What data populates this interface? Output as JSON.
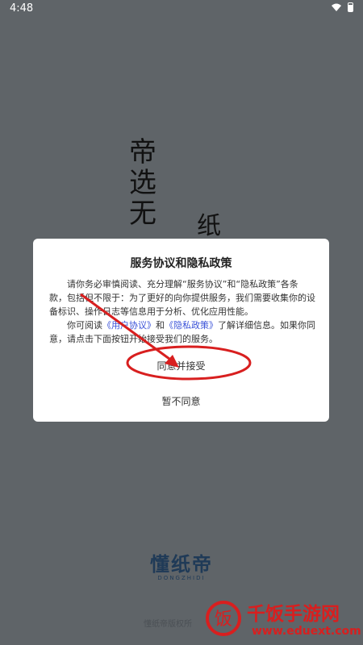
{
  "status": {
    "time": "4:48"
  },
  "splash": {
    "c1": "帝",
    "c2": "选",
    "c3": "无",
    "c4": "纸"
  },
  "dialog": {
    "title": "服务协议和隐私政策",
    "p1": "请你务必审慎阅读、充分理解“服务协议”和“隐私政策”各条款，包括但不限于：为了更好的向你提供服务，我们需要收集你的设备标识、操作日志等信息用于分析、优化应用性能。",
    "p2_prefix": "你可阅读",
    "link_user": "《用户协议》",
    "p2_and": "和",
    "link_privacy": "《隐私政策》",
    "p2_suffix": "了解详细信息。如果你同意，请点击下面按钮开始接受我们的服务。",
    "agree": "同意并接受",
    "disagree": "暂不同意"
  },
  "logo": {
    "main": "懂纸帝",
    "sub": "DONGZHIDI"
  },
  "footer": {
    "copyright": "懂纸帝版权所"
  },
  "watermark": {
    "name": "千饭手游网",
    "url": "www.eduext.com",
    "badge": "饭"
  },
  "colors": {
    "accent": "#d81f1f",
    "link": "#3a52d8"
  }
}
